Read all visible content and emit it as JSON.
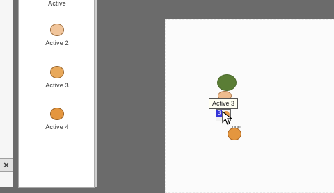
{
  "left_panel": {
    "close_glyph": "×"
  },
  "palette": {
    "items": [
      {
        "label": "Active",
        "color": "#f1c59b",
        "swatch_visible": false
      },
      {
        "label": "Active 2",
        "color": "#f1c59b",
        "swatch_visible": true
      },
      {
        "label": "Active 3",
        "color": "#e8a85a",
        "swatch_visible": true
      },
      {
        "label": "Active 4",
        "color": "#e4963f",
        "swatch_visible": true
      }
    ]
  },
  "canvas": {
    "tooltip": "Active 3",
    "drag_badge": "3",
    "cursor_hint": "ooo",
    "node_colors": {
      "green": "#5a7d35",
      "peach": "#efbc8e",
      "orange": "#e4963f"
    }
  }
}
